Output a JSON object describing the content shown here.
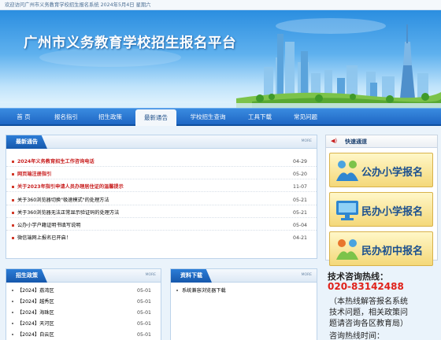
{
  "topbar": {
    "text": "欢迎访问广州市义务教育学校招生报名系统  2024年5月4日  星期六"
  },
  "banner": {
    "title": "广州市义务教育学校招生报名平台"
  },
  "nav": {
    "items": [
      {
        "label": "首 页"
      },
      {
        "label": "报名指引"
      },
      {
        "label": "招生政策"
      },
      {
        "label": "最新通告"
      },
      {
        "label": "学校招生查询"
      },
      {
        "label": "工具下载"
      },
      {
        "label": "常见问题"
      }
    ],
    "active_index": 3
  },
  "notices": {
    "title": "最新通告",
    "more": "MORE",
    "items": [
      {
        "text": "2024年义务教育招生工作咨询电话",
        "date": "04-29",
        "highlight": true
      },
      {
        "text": "网页端注册指引",
        "date": "05-20",
        "highlight": true
      },
      {
        "text": "关于2023年指引申请人员办理居住证的温馨提示",
        "date": "11-07",
        "highlight": true
      },
      {
        "text": "关于360浏览器切换\"极速模式\"的处理方法",
        "date": "05-21",
        "highlight": false
      },
      {
        "text": "关于360浏览器无法正常显示验证码的处理方法",
        "date": "05-21",
        "highlight": false
      },
      {
        "text": "公办小学户籍证明书填写说明",
        "date": "05-04",
        "highlight": false
      },
      {
        "text": "微信端网上报名已开启！",
        "date": "04-21",
        "highlight": false
      }
    ]
  },
  "policy": {
    "title": "招生政策",
    "more": "MORE",
    "items": [
      {
        "text": "【2024】荔湾区",
        "date": "05-01"
      },
      {
        "text": "【2024】越秀区",
        "date": "05-01"
      },
      {
        "text": "【2024】海珠区",
        "date": "05-01"
      },
      {
        "text": "【2024】天河区",
        "date": "05-01"
      },
      {
        "text": "【2024】白云区",
        "date": "05-01"
      }
    ]
  },
  "downloads": {
    "title": "资料下载",
    "more": "MORE",
    "items": [
      {
        "text": "系统兼容浏览器下载"
      }
    ]
  },
  "quick": {
    "title": "快速通道",
    "buttons": [
      {
        "label": "公办小学报名",
        "icon": "children-icon"
      },
      {
        "label": "民办小学报名",
        "icon": "monitor-icon"
      },
      {
        "label": "民办初中报名",
        "icon": "children-icon"
      }
    ]
  },
  "hotline": {
    "label": "技术咨询热线：",
    "number": "020-83142488",
    "note_lines": [
      "（本热线解答报名系统",
      "技术问题，相关政策问",
      "题请咨询各区教育局）",
      "咨询热线时间："
    ]
  },
  "colors": {
    "nav": "#1f67c4",
    "accent_red": "#c81e1e",
    "hotline_red": "#e0221a"
  }
}
